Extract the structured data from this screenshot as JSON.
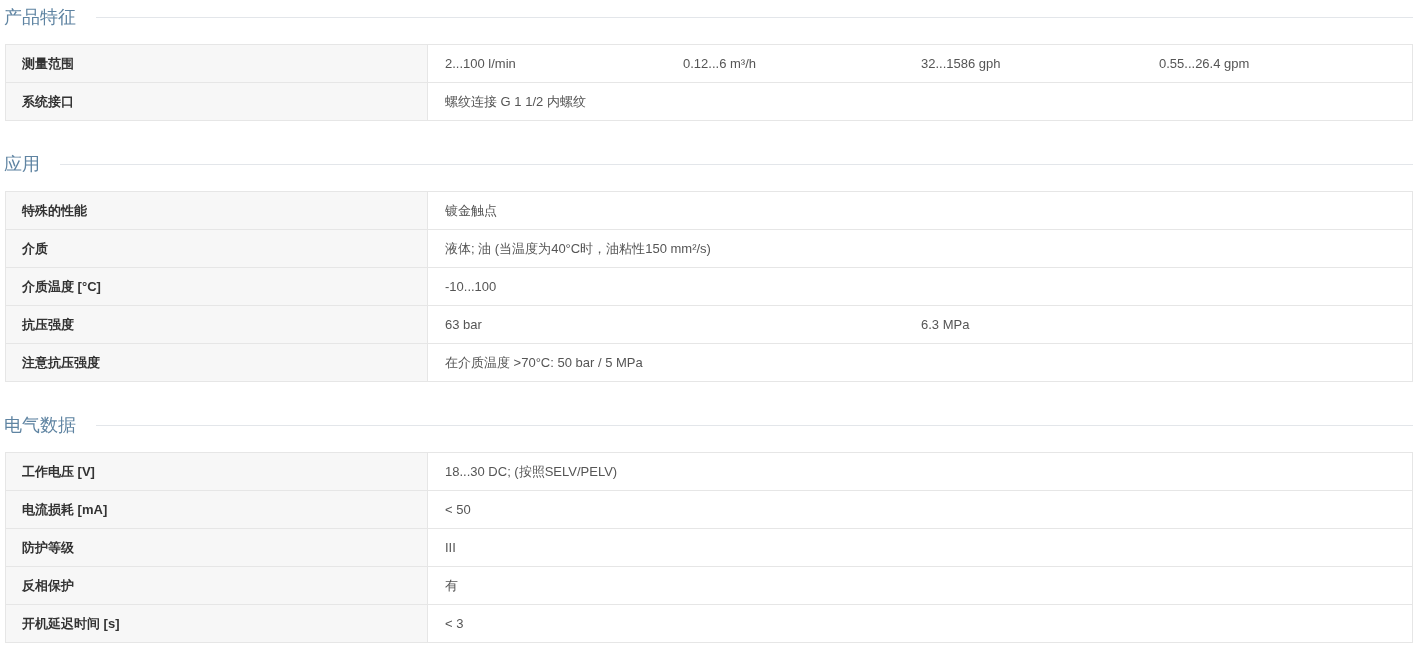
{
  "sections": [
    {
      "title": "产品特征",
      "rows": [
        {
          "label": "测量范围",
          "column_1": "2...100 l/min",
          "column_2": "0.12...6 m³/h",
          "column_3": "32...1586 gph",
          "column_4": "0.55...26.4 gpm"
        },
        {
          "label": "系统接口",
          "column_1": "螺纹连接 G 1 1/2 内螺纹"
        }
      ]
    },
    {
      "title": "应用",
      "rows": [
        {
          "label": "特殊的性能",
          "column_1": "镀金触点"
        },
        {
          "label": "介质",
          "column_1": "液体; 油 (当温度为40°C时，油粘性150 mm²/s)"
        },
        {
          "label": "介质温度 [°C]",
          "column_1": "-10...100"
        },
        {
          "label": "抗压强度",
          "column_1": "63 bar",
          "column_3": "6.3 MPa"
        },
        {
          "label": "注意抗压强度",
          "column_1": "在介质温度 >70°C: 50 bar / 5 MPa"
        }
      ]
    },
    {
      "title": "电气数据",
      "rows": [
        {
          "label": "工作电压 [V]",
          "column_1": "18...30 DC; (按照SELV/PELV)"
        },
        {
          "label": "电流损耗 [mA]",
          "column_1": "< 50"
        },
        {
          "label": "防护等级",
          "column_1": "III"
        },
        {
          "label": "反相保护",
          "column_1": "有"
        },
        {
          "label": "开机延迟时间 [s]",
          "column_1": "< 3"
        }
      ]
    }
  ]
}
